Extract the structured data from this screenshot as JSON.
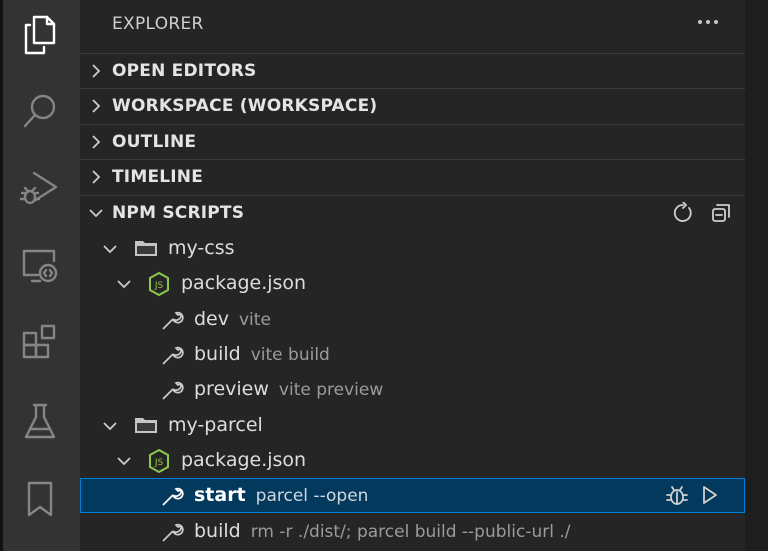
{
  "explorer": {
    "title": "EXPLORER"
  },
  "sections": {
    "open_editors": "OPEN EDITORS",
    "workspace": "WORKSPACE (WORKSPACE)",
    "outline": "OUTLINE",
    "timeline": "TIMELINE",
    "npm_scripts": "NPM SCRIPTS"
  },
  "tree": {
    "folder1": "my-css",
    "pkg1": "package.json",
    "scripts1": [
      {
        "name": "dev",
        "command": "vite"
      },
      {
        "name": "build",
        "command": "vite build"
      },
      {
        "name": "preview",
        "command": "vite preview"
      }
    ],
    "folder2": "my-parcel",
    "pkg2": "package.json",
    "scripts2": [
      {
        "name": "start",
        "command": "parcel --open"
      },
      {
        "name": "build",
        "command": "rm -r ./dist/; parcel build --public-url ./"
      }
    ]
  },
  "colors": {
    "accent": "#007fd4",
    "selection": "#04395e",
    "node_green": "#8cc84b",
    "folder": "#c5c5c5"
  }
}
